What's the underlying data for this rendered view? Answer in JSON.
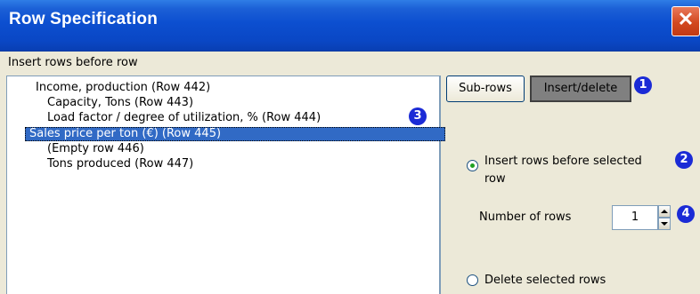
{
  "window": {
    "title": "Row Specification",
    "close_label": "✕"
  },
  "insert_label": "Insert rows before row",
  "list": {
    "items": [
      {
        "label": "Income, production (Row 442)",
        "selected": false
      },
      {
        "label": "Capacity, Tons (Row 443)",
        "selected": false
      },
      {
        "label": "Load factor / degree of utilization, % (Row 444)",
        "selected": false
      },
      {
        "label": "Sales price per ton (€) (Row 445)",
        "selected": true
      },
      {
        "label": "(Empty row 446)",
        "selected": false
      },
      {
        "label": "Tons produced (Row 447)",
        "selected": false
      }
    ]
  },
  "tabs": {
    "subrows_label": "Sub-rows",
    "insert_delete_label": "Insert/delete",
    "active": "Insert/delete"
  },
  "options": {
    "insert_before_line1": "Insert rows before selected",
    "insert_before_line2": "row",
    "insert_before_selected": true,
    "delete_selected": "Delete selected rows",
    "delete_checked": false
  },
  "number_of_rows": {
    "label": "Number of rows",
    "value": "1"
  },
  "badges": {
    "b1": "1",
    "b2": "2",
    "b3": "3",
    "b4": "4"
  },
  "colors": {
    "titlebar": "#0a47c5",
    "selection": "#316ac5",
    "badge": "#1b2bd6",
    "dialog_bg": "#ece9d8"
  }
}
